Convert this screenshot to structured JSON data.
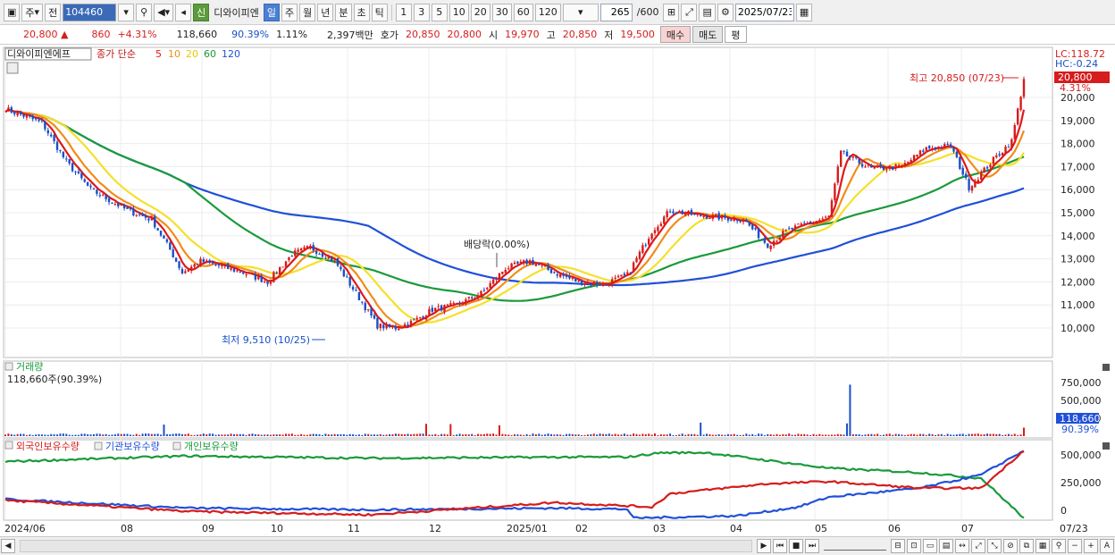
{
  "toolbar": {
    "period_label": "주",
    "prev_label": "전",
    "code": "104460",
    "badge": "신",
    "stock_name": "디와이피엔",
    "intervals": [
      "일",
      "주",
      "월",
      "년",
      "분",
      "초",
      "틱"
    ],
    "active_interval": "일",
    "numbers": [
      "1",
      "3",
      "5",
      "10",
      "20",
      "30",
      "60",
      "120"
    ],
    "count_value": "265",
    "count_total": "/600",
    "date": "2025/07/23"
  },
  "quote": {
    "price": "20,800",
    "change": "860",
    "change_pct": "+4.31%",
    "volume": "118,660",
    "vol_ratio": "90.39%",
    "turnover": "1.11%",
    "amount": "2,397백만",
    "ask_label": "호가",
    "ask1": "20,850",
    "bid1": "20,800",
    "open_label": "시",
    "open": "19,970",
    "high_label": "고",
    "high": "20,850",
    "low_label": "저",
    "low": "19,500",
    "buy_label": "매수",
    "sell_label": "매도",
    "avg_label": "평"
  },
  "chart": {
    "stock_name": "디와이피엔에프",
    "ma_label": "종가 단순",
    "ma_periods": [
      "5",
      "10",
      "20",
      "60",
      "120"
    ],
    "lc_label": "LC:118.72",
    "hc_label": "HC:-0.24",
    "current_price": "20,800",
    "current_pct": "4.31%",
    "high_annotation": "최고 20,850 (07/23)",
    "low_annotation": "최저 9,510 (10/25)",
    "dividend_annotation": "배당락(0.00%)",
    "price_axis": [
      "20,000",
      "19,000",
      "18,000",
      "17,000",
      "16,000",
      "15,000",
      "14,000",
      "13,000",
      "12,000",
      "11,000",
      "10,000"
    ],
    "volume_title": "거래량",
    "volume_text": "118,660주(90.39%)",
    "volume_axis": [
      "750,000",
      "500,000",
      "250,000"
    ],
    "volume_current": "118,660",
    "volume_pct": "90.39%",
    "holdings_legend": [
      "외국인보유수량",
      "기관보유수량",
      "개인보유수량"
    ],
    "holdings_axis": [
      "500,000",
      "250,000",
      "0"
    ],
    "dates": [
      "2024/06",
      "08",
      "09",
      "10",
      "11",
      "12",
      "2025/01",
      "02",
      "03",
      "04",
      "05",
      "06",
      "07"
    ],
    "last_date": "07/23",
    "colors": {
      "ma5": "#e01818",
      "ma10": "#f08c1c",
      "ma20": "#f5e02a",
      "ma60": "#1a9a3a",
      "ma120": "#2050d8",
      "up": "#d61c1c",
      "down": "#1a50c8"
    }
  },
  "chart_data": {
    "type": "line",
    "title": "디와이피엔에프",
    "x": [
      "2024/06",
      "08",
      "09",
      "10",
      "11",
      "12",
      "2025/01",
      "02",
      "03",
      "04",
      "05",
      "06",
      "07"
    ],
    "series": [
      {
        "name": "종가",
        "values": [
          19500,
          14200,
          12700,
          13200,
          10200,
          11700,
          12700,
          11800,
          15200,
          14000,
          17600,
          17000,
          20800
        ]
      }
    ],
    "ylim": [
      9500,
      21000
    ],
    "price_high": {
      "value": 20850,
      "date": "07/23"
    },
    "price_low": {
      "value": 9510,
      "date": "10/25"
    }
  }
}
